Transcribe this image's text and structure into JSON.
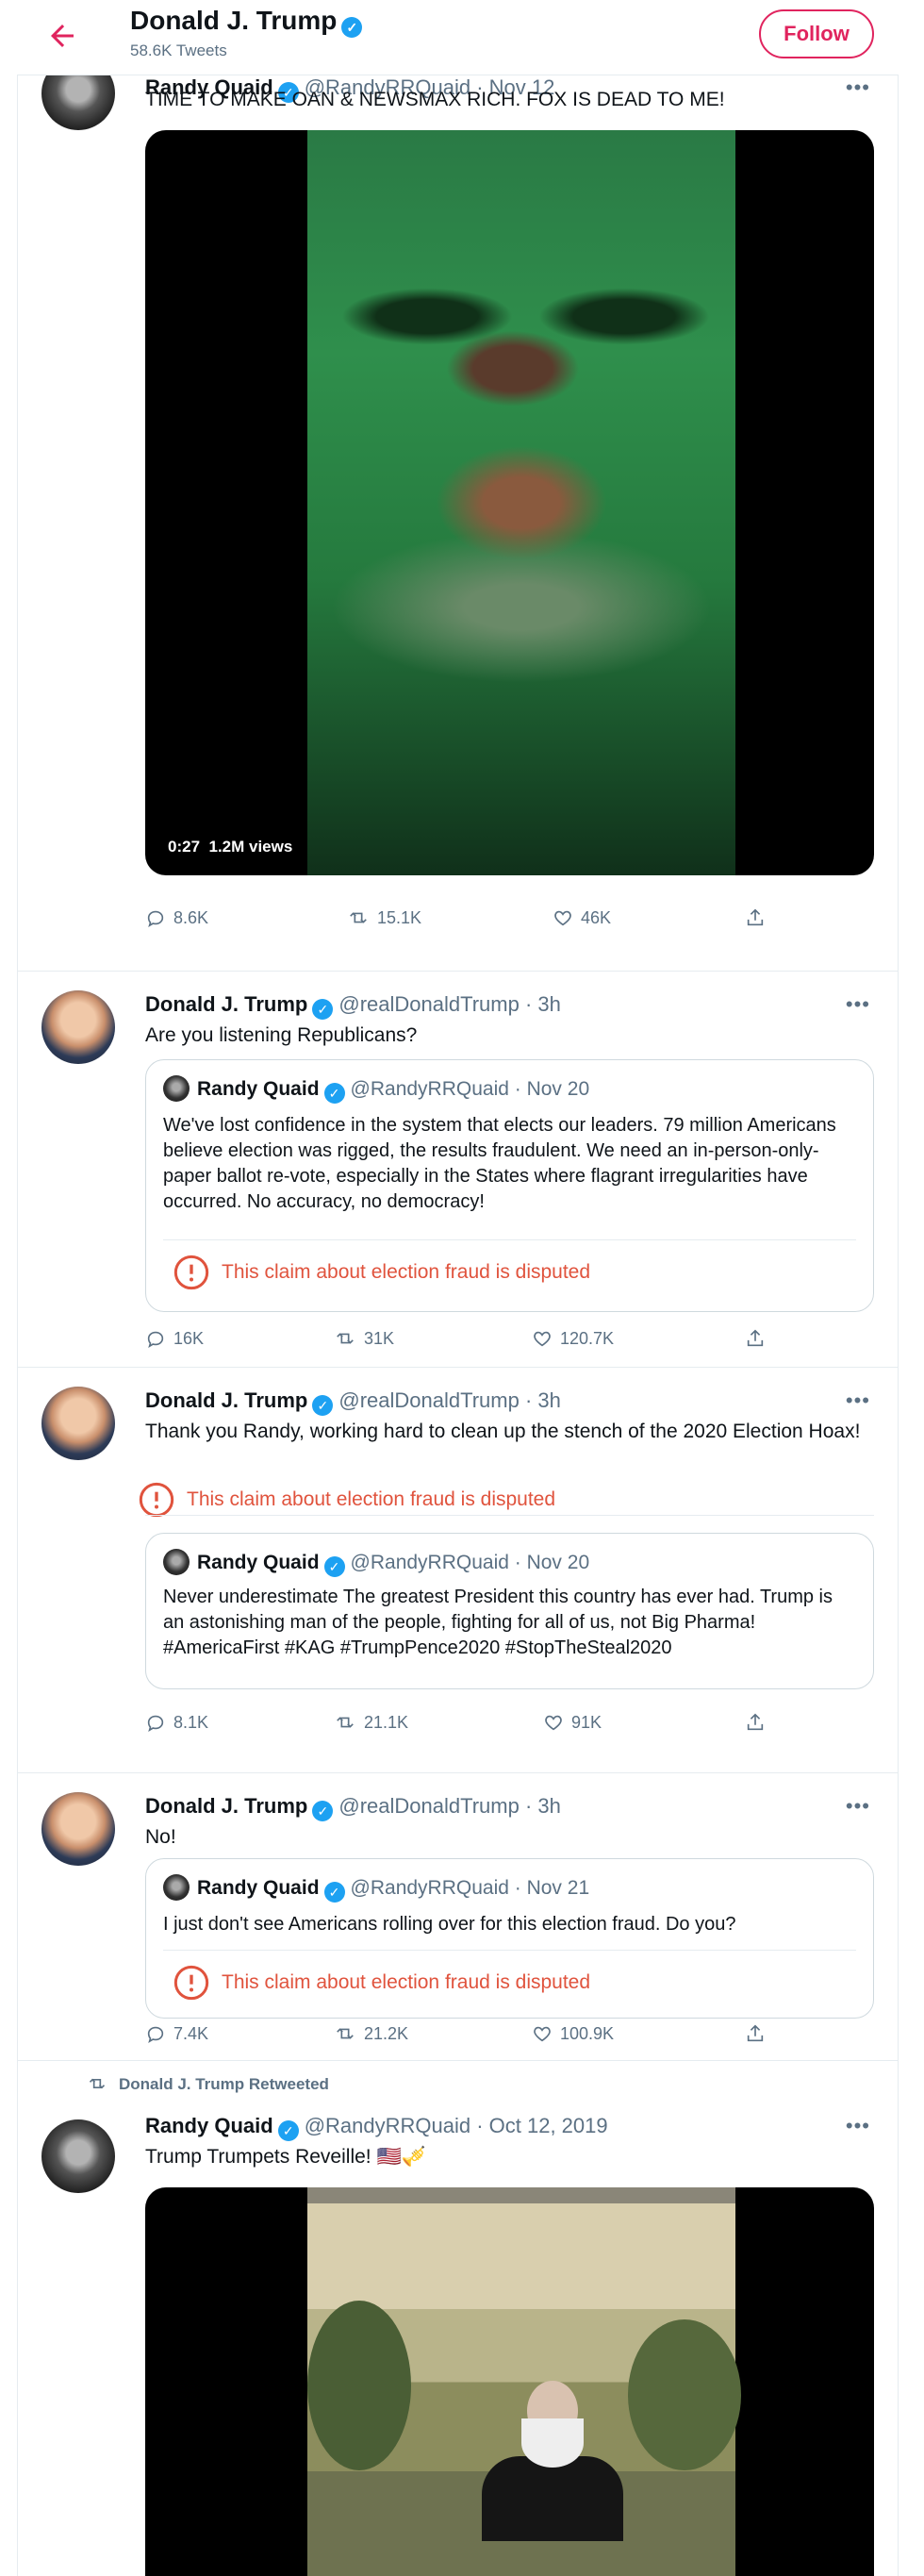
{
  "header": {
    "name": "Donald J. Trump",
    "tweet_count": "58.6K Tweets",
    "follow_label": "Follow"
  },
  "tweets": [
    {
      "user_name": "Randy Quaid",
      "handle_time": "@RandyRRQuaid · Nov 12",
      "text": "TIME TO MAKE OAN & NEWSMAX RICH. FOX IS DEAD TO ME!",
      "video": {
        "duration": "0:27",
        "views": "1.2M views"
      },
      "replies": "8.6K",
      "retweets": "15.1K",
      "likes": "46K"
    },
    {
      "user_name": "Donald J. Trump",
      "handle_time": "@realDonaldTrump · 3h",
      "text": "Are you listening Republicans?",
      "quote": {
        "user_name": "Randy Quaid",
        "handle_time": "@RandyRRQuaid · Nov 20",
        "text": "We've lost confidence in the system that elects our leaders. 79 million Americans believe election was rigged, the results fraudulent. We need an in-person-only-paper ballot re-vote, especially in the States where flagrant irregularities have occurred. No accuracy, no democracy!",
        "disputed": "This claim about election fraud is disputed"
      },
      "replies": "16K",
      "retweets": "31K",
      "likes": "120.7K"
    },
    {
      "user_name": "Donald J. Trump",
      "handle_time": "@realDonaldTrump · 3h",
      "text": "Thank you Randy, working hard to clean up the stench of the 2020 Election Hoax!",
      "disputed": "This claim about election fraud is disputed",
      "quote": {
        "user_name": "Randy Quaid",
        "handle_time": "@RandyRRQuaid · Nov 20",
        "text": "Never underestimate The greatest President this country has ever had. Trump is an astonishing man of the people, fighting for all of us, not Big Pharma! #AmericaFirst #KAG #TrumpPence2020 #StopTheSteal2020"
      },
      "replies": "8.1K",
      "retweets": "21.1K",
      "likes": "91K"
    },
    {
      "user_name": "Donald J. Trump",
      "handle_time": "@realDonaldTrump · 3h",
      "text": "No!",
      "quote": {
        "user_name": "Randy Quaid",
        "handle_time": "@RandyRRQuaid · Nov 21",
        "text": "I just don't see Americans rolling over for this election fraud. Do you?",
        "disputed": "This claim about election fraud is disputed"
      },
      "replies": "7.4K",
      "retweets": "21.2K",
      "likes": "100.9K"
    },
    {
      "retweet_label": "Donald J. Trump Retweeted",
      "user_name": "Randy Quaid",
      "handle_time": "@RandyRRQuaid · Oct 12, 2019",
      "text": "Trump Trumpets Reveille! 🇺🇸🎺"
    }
  ],
  "colors": {
    "accent": "#e0245e",
    "verified": "#1da1f2",
    "disputed": "#e0533d",
    "muted": "#5b7083"
  },
  "icons": [
    "back-arrow-icon",
    "verified-badge-icon",
    "reply-icon",
    "retweet-icon",
    "like-icon",
    "share-icon",
    "more-icon",
    "disputed-icon"
  ]
}
